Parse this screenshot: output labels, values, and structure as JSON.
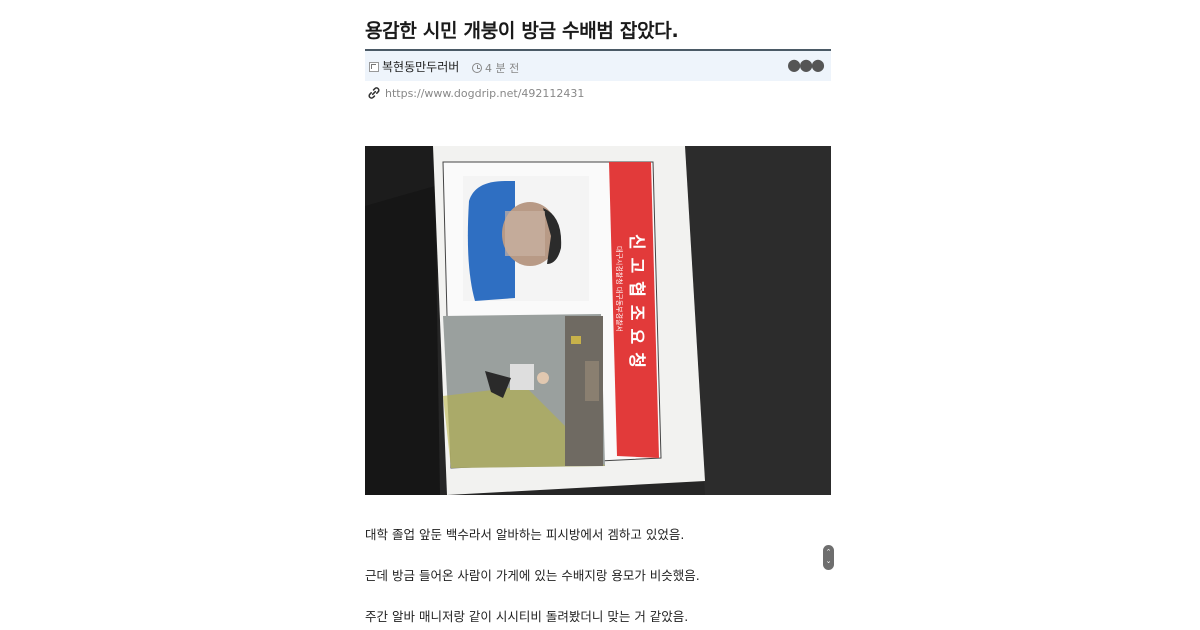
{
  "post": {
    "title": "용감한 시민 개붕이 방금 수배범 잡았다.",
    "author": "복현동만두러버",
    "time": "4 분 전",
    "url": "https://www.dogdrip.net/492112431"
  },
  "icons": {
    "author": "author-image-icon",
    "time": "clock-icon",
    "more": "more-options-icon",
    "link": "link-icon"
  },
  "photo": {
    "poster_heading": "신고협조요청",
    "poster_subheading": "대구시경찰청 대구동부경찰서"
  },
  "body": {
    "paragraphs": [
      "대학 졸업 앞둔 백수라서 알바하는 피시방에서 겜하고 있었음.",
      "근데  방금 들어온 사람이 가게에 있는 수배지랑 용모가 비슷했음.",
      "주간 알바 매니저랑 같이 시시티비 돌려봤더니 맞는 거 같았음."
    ]
  },
  "colors": {
    "meta_bg": "#eef4fb",
    "meta_border": "#4b5a66",
    "poster_red": "#e23a3a"
  }
}
